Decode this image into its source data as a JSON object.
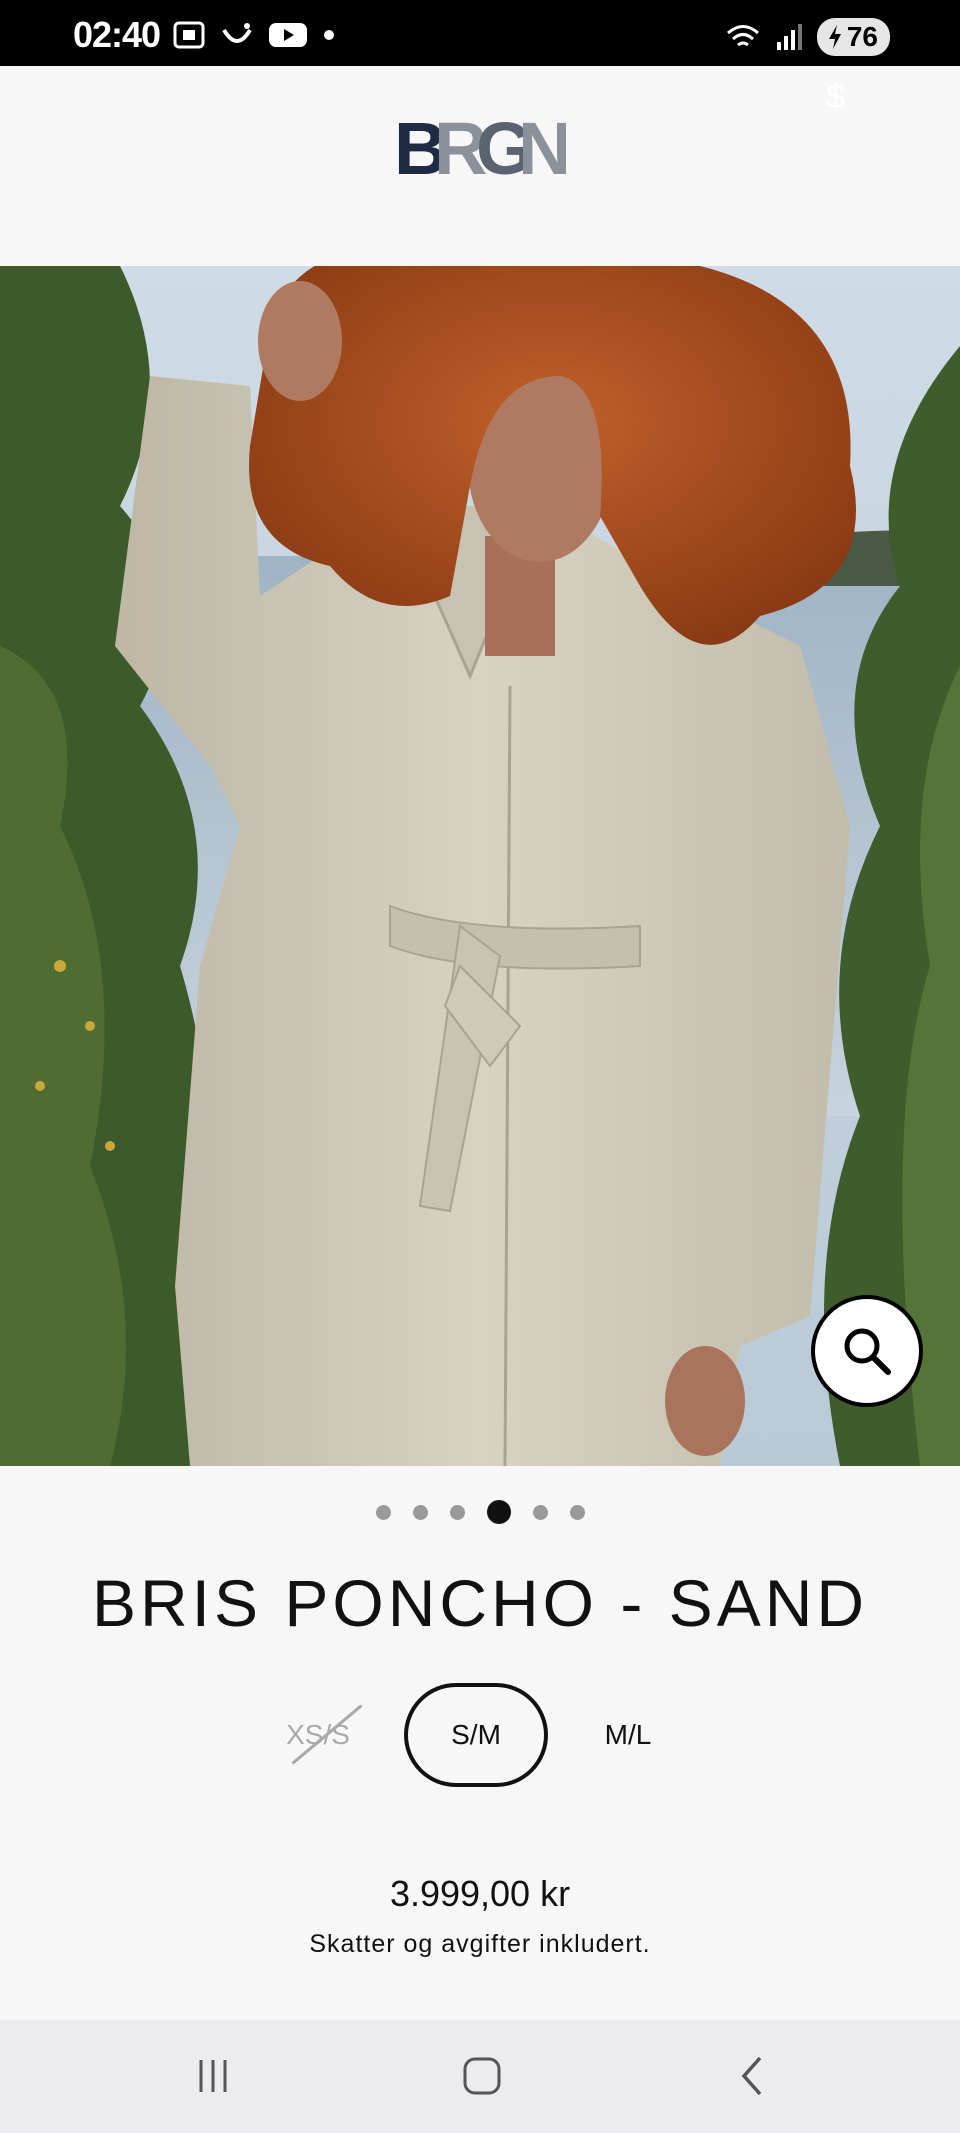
{
  "status_bar": {
    "time": "02:40",
    "battery": "76"
  },
  "header": {
    "logo_text": "BRGN"
  },
  "gallery": {
    "image_count": 6,
    "active_index": 3
  },
  "product": {
    "title": "BRIS PONCHO - SAND",
    "sizes": [
      {
        "label": "XS/S",
        "available": false,
        "selected": false
      },
      {
        "label": "S/M",
        "available": true,
        "selected": true
      },
      {
        "label": "M/L",
        "available": true,
        "selected": false
      }
    ],
    "price": "3.999,00 kr",
    "tax_note": "Skatter og avgifter inkludert."
  },
  "colors": {
    "logo_dark": "#1f2a44",
    "logo_gray": "#8c909a",
    "coat": "#cfcab9",
    "hair": "#b4541e"
  }
}
